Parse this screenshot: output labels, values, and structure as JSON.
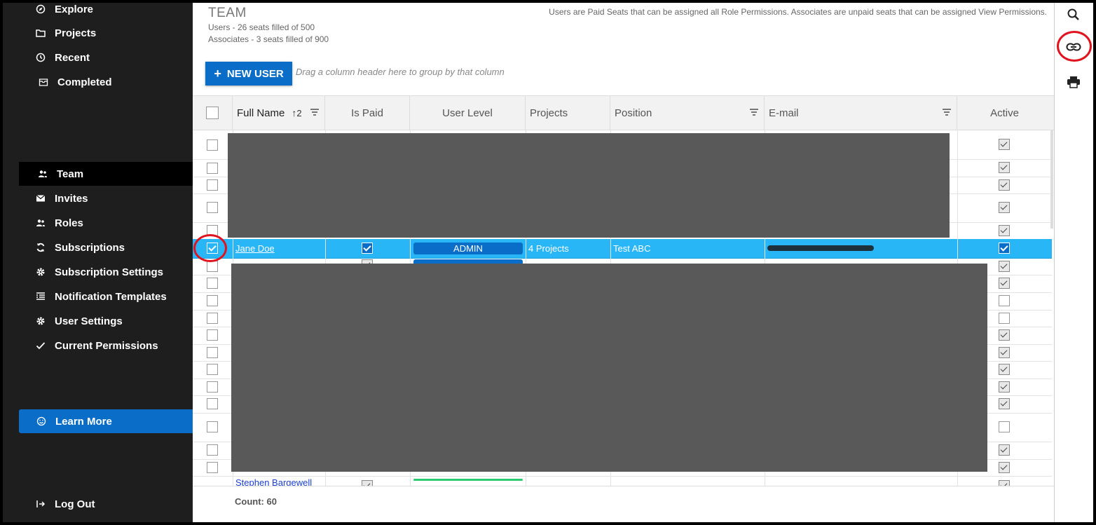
{
  "sidebar": {
    "items": [
      {
        "label": "Explore",
        "icon": "compass-icon"
      },
      {
        "label": "Projects",
        "icon": "folder-icon"
      },
      {
        "label": "Recent",
        "icon": "clock-icon"
      },
      {
        "label": "Completed",
        "icon": "archive-icon"
      },
      {
        "label": "Team",
        "icon": "team-icon",
        "active": true
      },
      {
        "label": "Invites",
        "icon": "envelope-icon"
      },
      {
        "label": "Roles",
        "icon": "roles-icon"
      },
      {
        "label": "Subscriptions",
        "icon": "sync-icon"
      },
      {
        "label": "Subscription Settings",
        "icon": "gear-icon"
      },
      {
        "label": "Notification Templates",
        "icon": "list-icon"
      },
      {
        "label": "User Settings",
        "icon": "gear-icon"
      },
      {
        "label": "Current Permissions",
        "icon": "checkmark-icon"
      }
    ],
    "learn_more": "Learn More",
    "log_out": "Log Out"
  },
  "header": {
    "title": "TEAM",
    "users_seats": "Users - 26 seats filled of 500",
    "associates_seats": "Associates - 3 seats filled of 900",
    "note": "Users are Paid Seats that can be assigned all Role Permissions. Associates are unpaid seats that can be assigned View Permissions."
  },
  "toolbar": {
    "new_user": "NEW USER",
    "group_hint": "Drag a column header here to group by that column"
  },
  "grid": {
    "columns": [
      "Full Name",
      "Is Paid",
      "User Level",
      "Projects",
      "Position",
      "E-mail",
      "Active"
    ],
    "sort_indicator": "2",
    "selected_row": {
      "full_name": "Jane Doe",
      "is_paid": true,
      "user_level": "ADMIN",
      "projects": "4 Projects",
      "position": "Test ABC",
      "active": true
    },
    "last_visible_name": "Stephen Bargewell",
    "count_label": "Count: 60"
  },
  "colors": {
    "sidebar_bg": "#1e1e1e",
    "accent": "#0a6ec8",
    "selected_row": "#29b6f6",
    "annotation": "#e0141e"
  }
}
